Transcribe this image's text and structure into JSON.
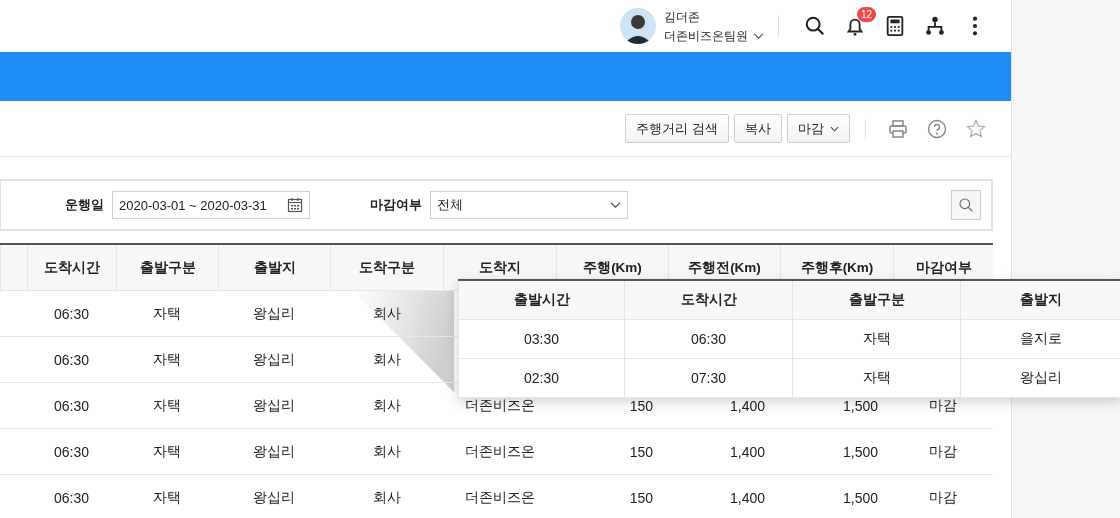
{
  "header": {
    "user": {
      "name": "김더존",
      "team": "더존비즈온팀원"
    },
    "notification_count": "12"
  },
  "toolbar": {
    "buttons": [
      {
        "label": "주행거리 검색",
        "kind": "plain"
      },
      {
        "label": "복사",
        "kind": "plain"
      },
      {
        "label": "마감",
        "kind": "dropdown"
      }
    ]
  },
  "filters": {
    "date": {
      "label": "운행일",
      "value": "2020-03-01 ~ 2020-03-31"
    },
    "status": {
      "label": "마감여부",
      "value": "전체"
    }
  },
  "table": {
    "columns": [
      {
        "label": "도착시간",
        "kind": "center"
      },
      {
        "label": "출발구분",
        "kind": "center"
      },
      {
        "label": "출발지",
        "kind": "center"
      },
      {
        "label": "도착구분",
        "kind": "center"
      },
      {
        "label": "도착지",
        "kind": "left"
      },
      {
        "label": "주행(Km)",
        "kind": "number"
      },
      {
        "label": "주행전(Km)",
        "kind": "number"
      },
      {
        "label": "주행후(Km)",
        "kind": "number"
      },
      {
        "label": "마감여부",
        "kind": "center"
      }
    ],
    "rows": [
      {
        "cells": [
          "06:30",
          "자택",
          "왕십리",
          "회사"
        ]
      },
      {
        "cells": [
          "06:30",
          "자택",
          "왕십리",
          "회사"
        ]
      },
      {
        "cells": [
          "06:30",
          "자택",
          "왕십리",
          "회사",
          "더존비즈온",
          "150",
          "1,400",
          "1,500",
          "마감"
        ]
      },
      {
        "cells": [
          "06:30",
          "자택",
          "왕십리",
          "회사",
          "더존비즈온",
          "150",
          "1,400",
          "1,500",
          "마감"
        ]
      },
      {
        "cells": [
          "06:30",
          "자택",
          "왕십리",
          "회사",
          "더존비즈온",
          "150",
          "1,400",
          "1,500",
          "마감"
        ]
      }
    ]
  },
  "popup": {
    "columns": [
      "출발시간",
      "도착시간",
      "출발구분",
      "출발지"
    ],
    "rows": [
      {
        "cells": [
          "03:30",
          "06:30",
          "자택",
          "을지로"
        ]
      },
      {
        "cells": [
          "02:30",
          "07:30",
          "자택",
          "왕십리"
        ]
      }
    ]
  }
}
